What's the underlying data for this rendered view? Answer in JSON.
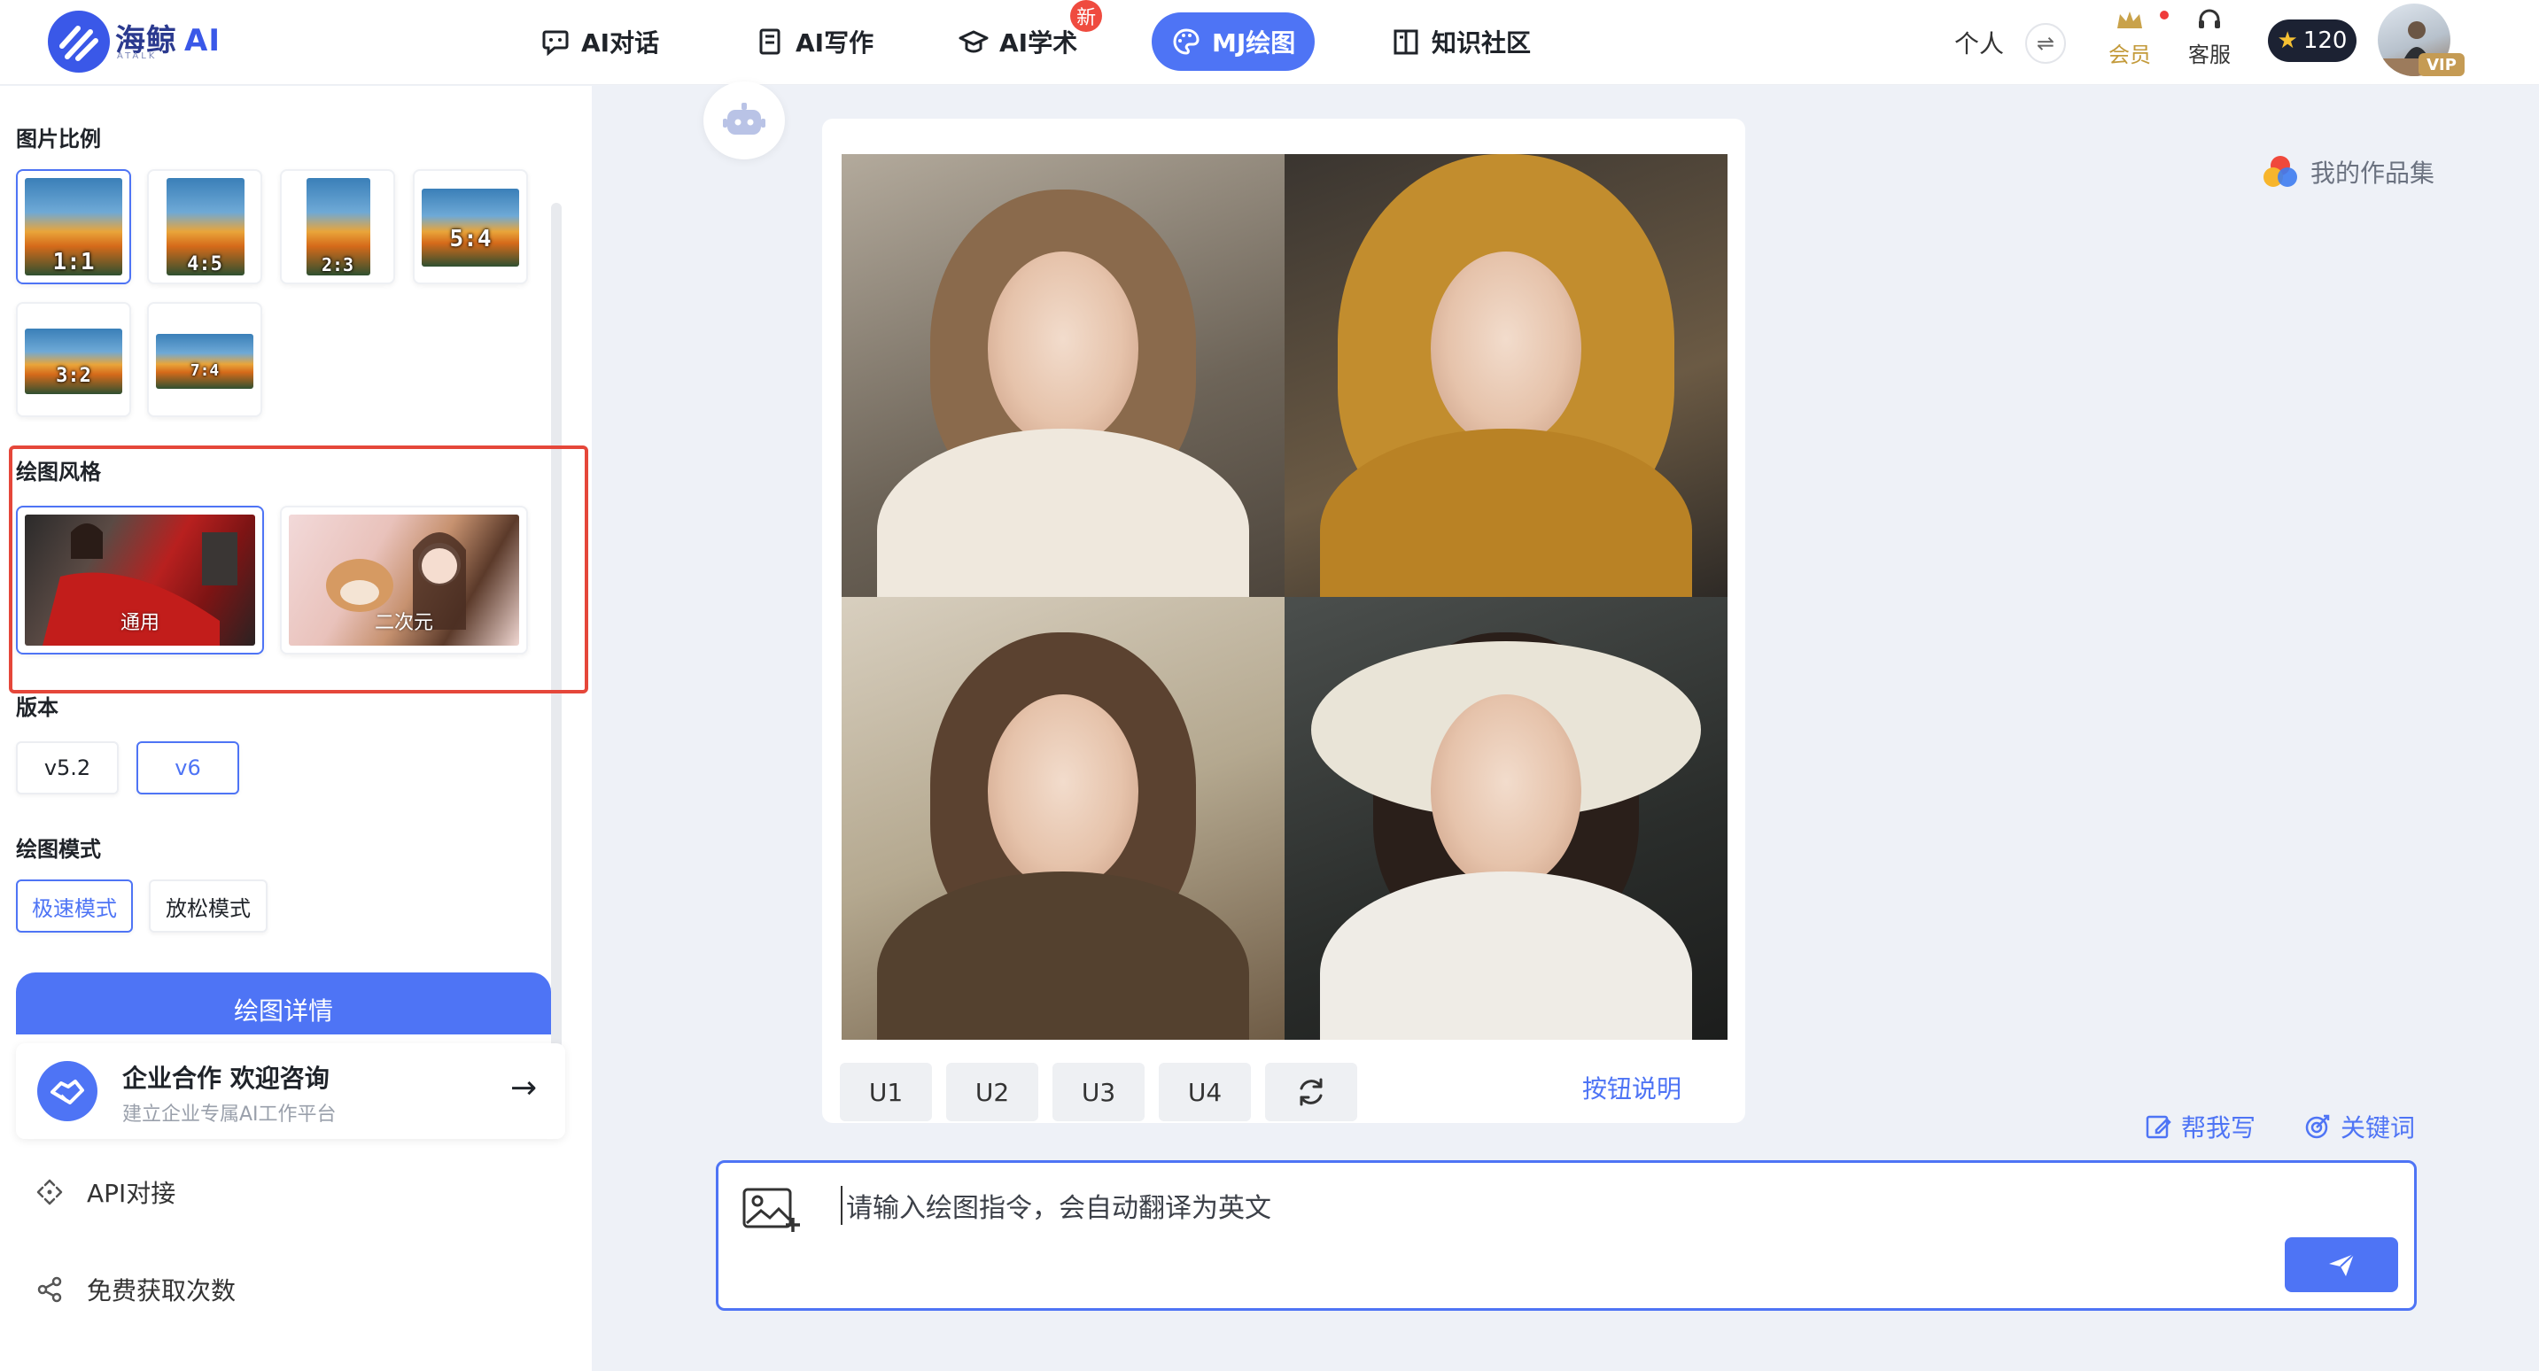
{
  "brand": {
    "name": "海鲸",
    "ai": "AI",
    "sub": "ATALK"
  },
  "nav": [
    {
      "label": "AI对话",
      "icon": "chat-icon"
    },
    {
      "label": "AI写作",
      "icon": "notebook-icon"
    },
    {
      "label": "AI学术",
      "icon": "mortarboard-icon",
      "badge": "新"
    },
    {
      "label": "MJ绘图",
      "icon": "palette-icon",
      "active": true
    },
    {
      "label": "知识社区",
      "icon": "book-icon"
    }
  ],
  "header_right": {
    "personal": "个人",
    "member": "会员",
    "service": "客服",
    "points": "120",
    "vip": "VIP"
  },
  "sidebar": {
    "ratio_title": "图片比例",
    "ratios": [
      "1:1",
      "4:5",
      "2:3",
      "5:4",
      "3:2",
      "7:4"
    ],
    "selected_ratio": "1:1",
    "style_title": "绘图风格",
    "styles": [
      "通用",
      "二次元"
    ],
    "selected_style": "通用",
    "version_title": "版本",
    "versions": [
      "v5.2",
      "v6"
    ],
    "selected_version": "v6",
    "mode_title": "绘图模式",
    "modes": [
      "极速模式",
      "放松模式"
    ],
    "selected_mode": "极速模式",
    "detail_button": "绘图详情",
    "coop_title": "企业合作 欢迎咨询",
    "coop_sub": "建立企业专属AI工作平台",
    "api_link": "API对接",
    "free_link": "免费获取次数"
  },
  "main": {
    "my_works": "我的作品集",
    "upscale_buttons": [
      "U1",
      "U2",
      "U3",
      "U4"
    ],
    "button_help": "按钮说明",
    "help_write": "帮我写",
    "keywords": "关键词",
    "prompt_placeholder": "请输入绘图指令，会自动翻译为英文"
  },
  "colors": {
    "accent": "#4e74f5",
    "highlight_box": "#e5473a",
    "badge_red": "#ef4b3f",
    "vip_gold": "#c59b54"
  }
}
